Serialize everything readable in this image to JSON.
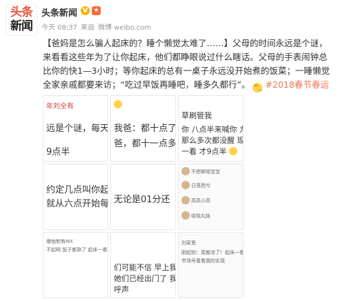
{
  "header": {
    "avatar_line1": "头条",
    "avatar_line2": "新闻",
    "name": "头条新闻",
    "badge": "V",
    "medal": "★",
    "time": "今天 08:37",
    "from": "来自",
    "source": "微博 weibo.com"
  },
  "post": {
    "text_part1": "【爸妈是怎么骗人起床的？睡个懒觉太难了……】父母的时间永远是个谜，来看看这些年为了让你起床，他们都睁眼说过什么瞎话。父母的手表闹钟总比你的快1—3小时；等你起床的总有一桌子永远没开始煮的饭菜；一睡懒觉全家亲戚都要来访；“吃过早饭再睡吧，睡多久都行”。",
    "emoji": "😉",
    "hashtag": "#2018春节春运#"
  },
  "tiles": {
    "t1": {
      "l1": "年刘全有",
      "l2": "远是个谜，每天早",
      "l3": "9点半"
    },
    "t2": {
      "l1": "我爸：都十点了",
      "l2": "爸，都十一点多了"
    },
    "t3": {
      "l1": "草刷管我",
      "l2": "你 八点半来喊你 九",
      "l3": "那么多次都没醒 现在",
      "l4": "一看 才9点半"
    },
    "t4": {
      "l1": "约定几点叫你起床",
      "l2": "就从六点开始每隔"
    },
    "t5": {
      "l1": "无论是01分还"
    },
    "t6": {
      "a": "不挖断呢宝宝",
      "b": "日落西兮",
      "c": "高高小高",
      "d": "吸晓丸娃"
    },
    "t7": {
      "l1": "爆他制有MX",
      "l2": "不起啊 饭子都熟了 起床一看还没"
    },
    "t8": {
      "l1": "们可能不信 早上我",
      "l2": "她们已经出门了 我",
      "l3": "呼声"
    },
    "t9": {
      "l1": "刘家思",
      "l2": "刚起别：菜都凉了！起床一看",
      "l3": "市场号看看我的实现"
    }
  }
}
